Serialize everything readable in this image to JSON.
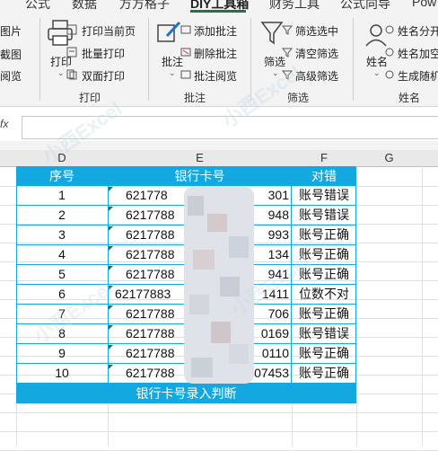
{
  "tabs": [
    "公式",
    "数据",
    "方方格子",
    "DIY工具箱",
    "财务工具",
    "公式向导",
    "Pow"
  ],
  "ribbon": {
    "left_items": [
      "图片",
      "截图",
      "阅览"
    ],
    "print_group": {
      "big_button": "打印",
      "items": [
        "打印当前页",
        "批量打印",
        "双面打印"
      ],
      "label": "打印"
    },
    "annotate_group": {
      "big_button": "批注",
      "items": [
        "添加批注",
        "删除批注",
        "批注阅览"
      ],
      "label": "批注"
    },
    "filter_group": {
      "big_button": "筛选",
      "items": [
        "筛选选中",
        "清空筛选",
        "高级筛选"
      ],
      "label": "筛选"
    },
    "name_group": {
      "big_button": "姓名",
      "items": [
        "姓名分开",
        "姓名加空",
        "生成随机"
      ],
      "label": "姓名"
    }
  },
  "formula_bar": {
    "fx": "fx",
    "value": ""
  },
  "columns": [
    "D",
    "E",
    "F",
    "G"
  ],
  "table": {
    "headers": [
      "序号",
      "银行卡号",
      "对错"
    ],
    "rows": [
      {
        "no": "1",
        "card_prefix": "621778",
        "card_suffix": "301",
        "result": "账号错误"
      },
      {
        "no": "2",
        "card_prefix": "6217788",
        "card_suffix": "948",
        "result": "账号错误"
      },
      {
        "no": "3",
        "card_prefix": "6217788",
        "card_suffix": "993",
        "result": "账号正确"
      },
      {
        "no": "4",
        "card_prefix": "6217788",
        "card_suffix": "134",
        "result": "账号正确"
      },
      {
        "no": "5",
        "card_prefix": "6217788",
        "card_suffix": "941",
        "result": "账号正确"
      },
      {
        "no": "6",
        "card_prefix": "62177883",
        "card_suffix": "1411",
        "result": "位数不对"
      },
      {
        "no": "7",
        "card_prefix": "6217788",
        "card_suffix": "706",
        "result": "账号正确"
      },
      {
        "no": "8",
        "card_prefix": "6217788",
        "card_suffix": "0169",
        "result": "账号错误"
      },
      {
        "no": "9",
        "card_prefix": "6217788",
        "card_suffix": "0110",
        "result": "账号正确"
      },
      {
        "no": "10",
        "card_prefix": "6217788",
        "card_suffix": "07453",
        "result": "账号正确"
      }
    ],
    "footer": "银行卡号录入判断"
  },
  "watermark": "小西Excel",
  "colors": {
    "header_blue": "#13a9e0",
    "border_blue": "#13a9e0",
    "excel_green": "#217346"
  }
}
